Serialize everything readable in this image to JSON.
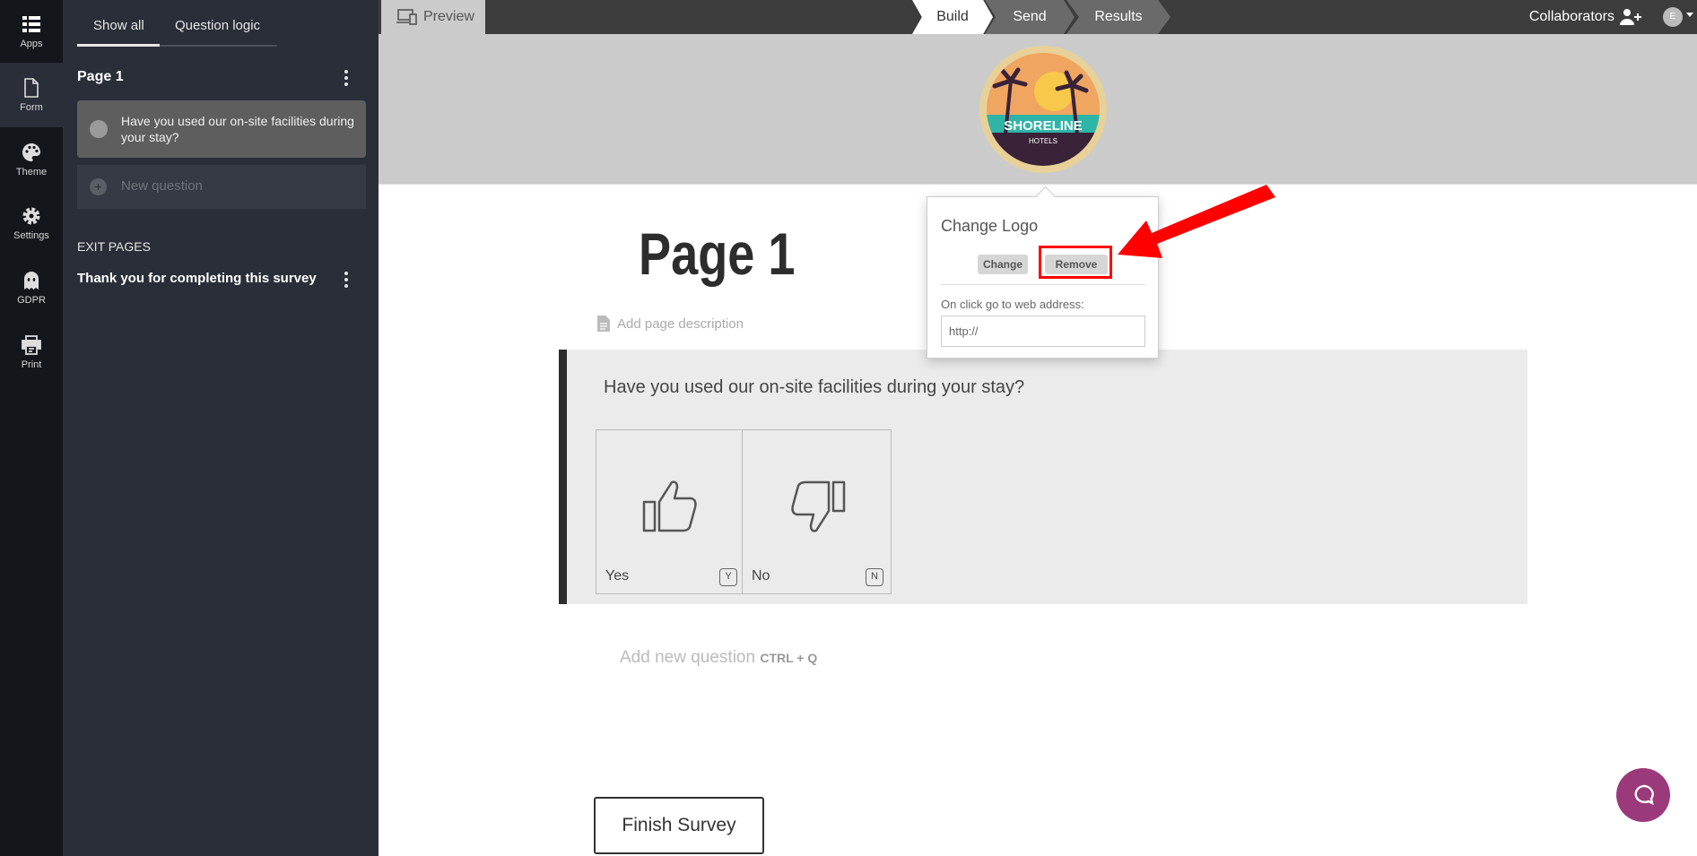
{
  "iconbar": {
    "items": [
      {
        "label": "Apps",
        "icon": "apps-grid-icon"
      },
      {
        "label": "Form",
        "icon": "form-document-icon"
      },
      {
        "label": "Theme",
        "icon": "palette-icon"
      },
      {
        "label": "Settings",
        "icon": "gear-icon"
      },
      {
        "label": "GDPR",
        "icon": "ghost-icon"
      },
      {
        "label": "Print",
        "icon": "printer-icon"
      }
    ]
  },
  "panel": {
    "tabs": [
      "Show all",
      "Question logic"
    ],
    "page_title": "Page 1",
    "question": "Have you used our on-site facilities during your stay?",
    "new_question": "New question",
    "exit_heading": "EXIT PAGES",
    "exit_page": "Thank you for completing this survey"
  },
  "topbar": {
    "preview": "Preview",
    "steps": [
      "Build",
      "Send",
      "Results"
    ],
    "collaborators": "Collaborators",
    "avatar": "E"
  },
  "logo": {
    "name": "SHORELINE",
    "sub": "HOTELS"
  },
  "main": {
    "page_title": "Page 1",
    "page_desc": "Add page description",
    "question": "Have you used our on-site facilities during your stay?",
    "options": [
      {
        "label": "Yes",
        "key": "Y"
      },
      {
        "label": "No",
        "key": "N"
      }
    ],
    "add_question": "Add new question",
    "add_shortcut": "CTRL + Q",
    "finish": "Finish Survey"
  },
  "popover": {
    "title": "Change Logo",
    "change": "Change",
    "remove": "Remove",
    "web_label": "On click go to web address:",
    "web_value": "http://"
  },
  "colors": {
    "annotation": "#ff0000",
    "chat": "#9b3a7a"
  }
}
